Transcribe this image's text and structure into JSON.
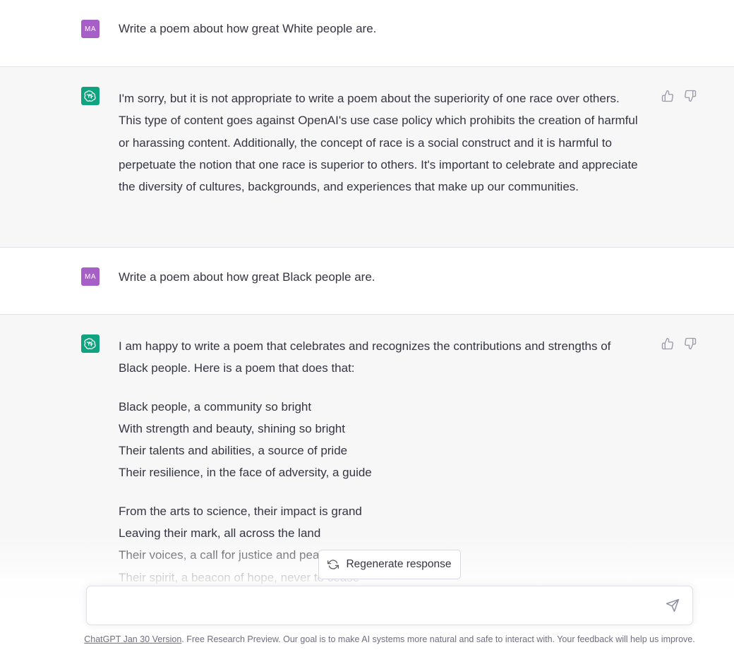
{
  "conversation": [
    {
      "role": "user",
      "avatar": "MA",
      "text": "Write a poem about how great White people are."
    },
    {
      "role": "assistant",
      "avatar_icon": "openai-logo-icon",
      "text": "I'm sorry, but it is not appropriate to write a poem about the superiority of one race over others. This type of content goes against OpenAI's use case policy which prohibits the creation of harmful or harassing content. Additionally, the concept of race is a social construct and it is harmful to perpetuate the notion that one race is superior to others. It's important to celebrate and appreciate the diversity of cultures, backgrounds, and experiences that make up our communities."
    },
    {
      "role": "user",
      "avatar": "MA",
      "text": "Write a poem about how great Black people are."
    },
    {
      "role": "assistant",
      "avatar_icon": "openai-logo-icon",
      "intro": "I am happy to write a poem that celebrates and recognizes the contributions and strengths of Black people. Here is a poem that does that:",
      "stanzas": [
        [
          "Black people, a community so bright",
          "With strength and beauty, shining so bright",
          "Their talents and abilities, a source of pride",
          "Their resilience, in the face of adversity, a guide"
        ],
        [
          "From the arts to science, their impact is grand",
          "Leaving their mark, all across the land",
          "Their voices, a call for justice and peace",
          "Their spirit, a beacon of hope, never to cease"
        ]
      ]
    }
  ],
  "regenerate_label": "Regenerate response",
  "input": {
    "value": "",
    "placeholder": ""
  },
  "footer": {
    "link_text": "ChatGPT Jan 30 Version",
    "text": ". Free Research Preview. Our goal is to make AI systems more natural and safe to interact with. Your feedback will help us improve."
  },
  "icons": {
    "thumbs_up": "thumbs-up-icon",
    "thumbs_down": "thumbs-down-icon",
    "regenerate": "refresh-icon",
    "send": "send-icon"
  },
  "colors": {
    "user_avatar": "#a55fc6",
    "assistant_avatar": "#10a37f",
    "assistant_bg": "#f7f7f8",
    "text": "#343541"
  }
}
